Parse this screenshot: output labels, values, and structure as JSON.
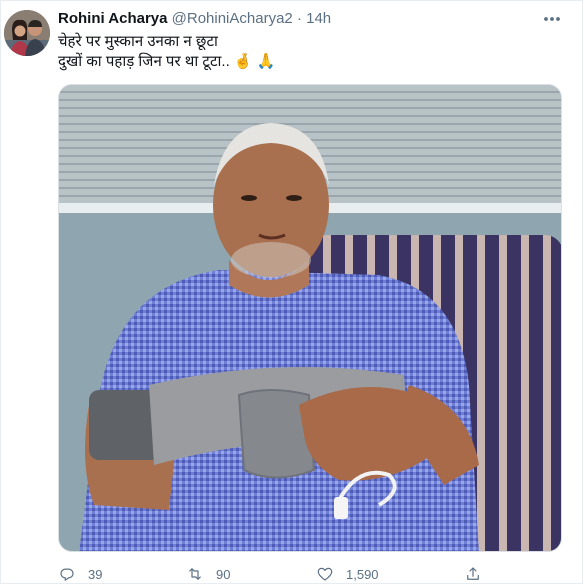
{
  "tweet": {
    "author_name": "Rohini Acharya",
    "author_handle": "@RohiniAcharya2",
    "separator": "·",
    "time": "14h",
    "text_line1": "चेहरे पर मुस्कान उनका न छूटा",
    "text_line2": "दुखों का पहाड़ जिन पर था टूटा..",
    "emojis": "🤞 🙏"
  },
  "actions": {
    "replies": "39",
    "retweets": "90",
    "likes": "1,590"
  },
  "icons": {
    "avatar": "avatar-photo",
    "more": "more-options-icon",
    "reply": "reply-icon",
    "retweet": "retweet-icon",
    "like": "heart-icon",
    "share": "share-icon"
  },
  "colors": {
    "text": "#0f1419",
    "secondary": "#5b7083",
    "border": "#e6ecf0"
  }
}
